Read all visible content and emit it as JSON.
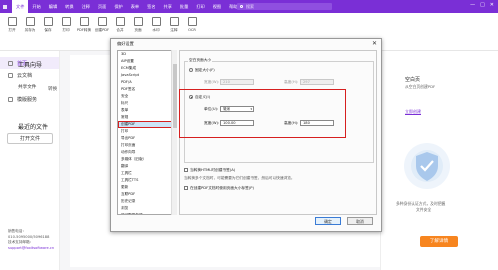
{
  "titlebar": {
    "menus": [
      "文件",
      "开始",
      "编辑",
      "转换",
      "注释",
      "页面",
      "保护",
      "表单",
      "签名",
      "共享",
      "批量",
      "打印",
      "视图",
      "帮助",
      "文档比较"
    ],
    "active_menu": "文件",
    "search_placeholder": "搜索",
    "window_controls": [
      "—",
      "□",
      "✕"
    ]
  },
  "toolbar": {
    "tools": [
      {
        "label": "打开",
        "icon": "open-icon"
      },
      {
        "label": "另存为",
        "icon": "save-as-icon"
      },
      {
        "label": "保存",
        "icon": "save-icon"
      },
      {
        "label": "打印",
        "icon": "print-icon"
      },
      {
        "label": "PDF转换",
        "icon": "convert-icon"
      },
      {
        "label": "创建PDF",
        "icon": "create-pdf-icon"
      },
      {
        "label": "合并",
        "icon": "merge-icon"
      },
      {
        "label": "页面",
        "icon": "page-icon"
      },
      {
        "label": "水印",
        "icon": "watermark-icon"
      },
      {
        "label": "注释",
        "icon": "comment-icon"
      },
      {
        "label": "OCR",
        "icon": "ocr-icon"
      }
    ]
  },
  "sidebar": {
    "items": [
      {
        "label": "首页",
        "icon": "home-icon",
        "active": true
      },
      {
        "label": "云文档",
        "icon": "cloud-icon"
      },
      {
        "label": "共享文件",
        "icon": "share-icon",
        "sub": true
      },
      {
        "label": "模版服务",
        "icon": "template-icon"
      }
    ],
    "open_button": "打开文件",
    "contact": {
      "line1": "销售电话：",
      "line2": "010-5095000/5096188",
      "line3": "技术支持邮箱：",
      "line4": "support@foxitsoftware.cn"
    }
  },
  "home": {
    "tools_title": "工具向导",
    "tools_sub": "转换",
    "recent_title": "最近的文件"
  },
  "right_panel": {
    "blank_title": "空白页",
    "blank_desc": "从空白页创建PDF",
    "blank_link": "立即创建",
    "security_line1": "多种身份认证方式，及时把握",
    "security_line2": "文件安全",
    "cta": "了解详情"
  },
  "dialog": {
    "title": "偏好设置",
    "close": "✕",
    "categories": [
      "3D",
      "AIP设置",
      "ECM集成",
      "JavaScript",
      "PDF/A",
      "PDF签名",
      "安全",
      "标尺",
      "表单",
      "常规",
      "创建PDF",
      "打印",
      "导出PDF",
      "打印页面",
      "动作向导",
      "多媒体（旧版）",
      "翻译",
      "工具栏",
      "工具栏TTS",
      "更新",
      "互联PDF",
      "历史记录",
      "浏览",
      "时间戳服务器",
      "签名",
      "身份"
    ],
    "selected_category": "创建PDF",
    "page_size_group": "空白页面大小",
    "fixed_size_label": "固定大小(F)",
    "fixed_width_label": "宽度(W):",
    "fixed_width_value": "210",
    "fixed_height_label": "高度(H):",
    "fixed_height_value": "297",
    "custom_size_label": "自定义(I)",
    "unit_label": "单位(U):",
    "unit_value": "毫米",
    "custom_width_label": "宽度(W):",
    "custom_width_value": "100.00",
    "custom_height_label": "高度(H):",
    "custom_height_value": "180",
    "check1": "当转换HTML时创建书签(A)",
    "check1_desc": "当转换多个文档时，可能需要为它们创建书签，然后可以快速浏览。",
    "check2": "在创建PDF文档时使用页面大小标签(P)",
    "ok": "确定",
    "cancel": "取消"
  }
}
